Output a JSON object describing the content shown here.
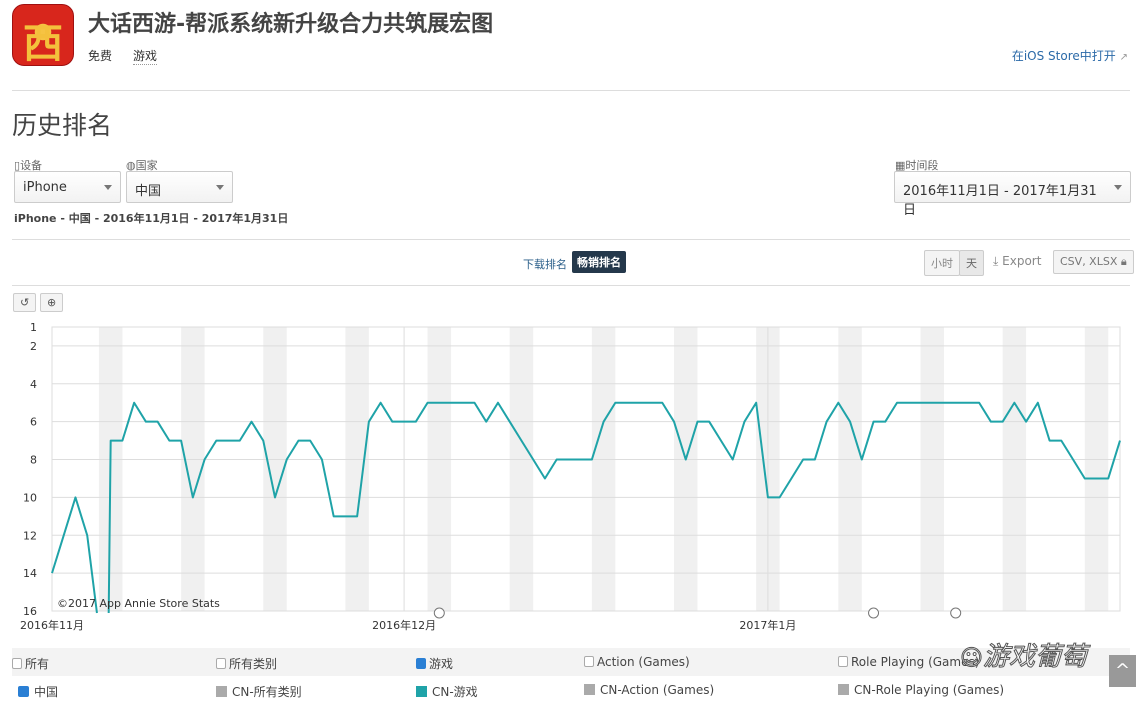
{
  "app": {
    "icon_text": "西",
    "title": "大话西游-帮派系统新升级合力共筑展宏图",
    "price": "免费",
    "category": "游戏",
    "store_link": "在iOS Store中打开"
  },
  "section_title": "历史排名",
  "filters": {
    "device_label": "设备",
    "device_value": "iPhone",
    "country_label": "国家",
    "country_value": "中国",
    "period_label": "时间段",
    "period_value": "2016年11月1日 - 2017年1月31日"
  },
  "subtitle": "iPhone - 中国 - 2016年11月1日 - 2017年1月31日",
  "rank_tabs": {
    "downloads": "下载排名",
    "grossing": "畅销排名",
    "active": "grossing"
  },
  "toolbar": {
    "hour": "小时",
    "day": "天",
    "export": "Export",
    "formats": "CSV, XLSX"
  },
  "chart_data": {
    "type": "line",
    "credit": "©2017 App Annie Store Stats",
    "y_inverted": true,
    "ylim": [
      1,
      16
    ],
    "y_ticks": [
      "1",
      "2",
      "4",
      "6",
      "8",
      "10",
      "12",
      "14",
      "16"
    ],
    "x_start": "2016-11-01",
    "x_end": "2017-01-31",
    "x_ticks": [
      {
        "date": "2016-11-01",
        "label": "2016年11月"
      },
      {
        "date": "2016-12-01",
        "label": "2016年12月"
      },
      {
        "date": "2017-01-01",
        "label": "2017年1月"
      }
    ],
    "weekend_shading": true,
    "annotations": [
      "2016-12-04",
      "2017-01-10",
      "2017-01-17"
    ],
    "series": [
      {
        "name": "CN-游戏",
        "color": "#1fa3a8",
        "values": [
          14,
          12,
          10,
          12,
          null,
          7,
          7,
          5,
          6,
          6,
          7,
          7,
          10,
          8,
          7,
          7,
          7,
          6,
          7,
          10,
          8,
          7,
          7,
          8,
          11,
          11,
          11,
          6,
          5,
          6,
          6,
          6,
          5,
          5,
          5,
          5,
          5,
          6,
          5,
          6,
          7,
          8,
          9,
          8,
          8,
          8,
          8,
          6,
          5,
          5,
          5,
          5,
          5,
          6,
          8,
          6,
          6,
          7,
          8,
          6,
          5,
          10,
          10,
          9,
          8,
          8,
          6,
          5,
          6,
          8,
          6,
          6,
          5,
          5,
          5,
          5,
          5,
          5,
          5,
          5,
          6,
          6,
          5,
          6,
          5,
          7,
          7,
          8,
          9,
          9,
          9,
          7
        ]
      }
    ]
  },
  "legend": {
    "categories": [
      {
        "label": "所有",
        "checked": false
      },
      {
        "label": "所有类别",
        "checked": false
      },
      {
        "label": "游戏",
        "checked": true
      },
      {
        "label": "Action (Games)",
        "checked": false
      },
      {
        "label": "Role Playing (Games)",
        "checked": false
      }
    ],
    "series": [
      {
        "label": "中国",
        "color": "#2a7fd4"
      },
      {
        "label": "CN-所有类别",
        "color": "#aaaaaa"
      },
      {
        "label": "CN-游戏",
        "color": "#1fa3a8"
      },
      {
        "label": "CN-Action (Games)",
        "color": "#aaaaaa"
      },
      {
        "label": "CN-Role Playing (Games)",
        "color": "#aaaaaa"
      }
    ]
  },
  "watermark": "游戏葡萄"
}
